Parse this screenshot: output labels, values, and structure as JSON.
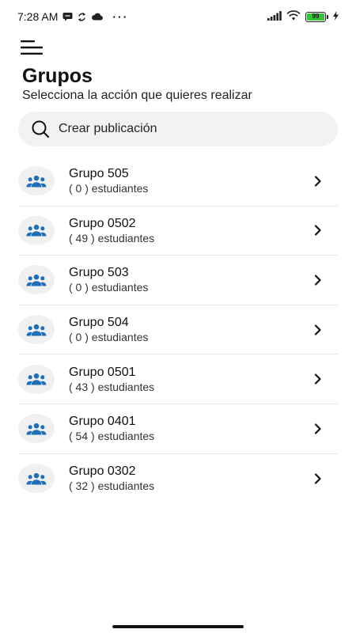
{
  "status_bar": {
    "time": "7:28 AM",
    "dots": "···",
    "battery_level": "99",
    "icons": [
      "chat-bubble-icon",
      "sync-icon",
      "cloud-icon",
      "signal-icon",
      "wifi-icon",
      "battery-icon",
      "charging-icon"
    ]
  },
  "header": {
    "menu_icon": "menu-icon",
    "title": "Grupos",
    "subtitle": "Selecciona la acción que quieres realizar"
  },
  "search": {
    "label": "Crear publicación",
    "icon": "search-icon"
  },
  "groups": [
    {
      "name": "Grupo 505",
      "count": "( 0 ) estudiantes"
    },
    {
      "name": "Grupo 0502",
      "count": "( 49 ) estudiantes"
    },
    {
      "name": "Grupo 503",
      "count": "( 0 ) estudiantes"
    },
    {
      "name": "Grupo 504",
      "count": "( 0 ) estudiantes"
    },
    {
      "name": "Grupo 0501",
      "count": "( 43 ) estudiantes"
    },
    {
      "name": "Grupo 0401",
      "count": "( 54 ) estudiantes"
    },
    {
      "name": "Grupo 0302",
      "count": "( 32 ) estudiantes"
    }
  ],
  "colors": {
    "accent": "#1e6fb8",
    "avatar_bg": "#f0f0f0",
    "search_bg": "#f2f2f2",
    "battery": "#37c337"
  }
}
